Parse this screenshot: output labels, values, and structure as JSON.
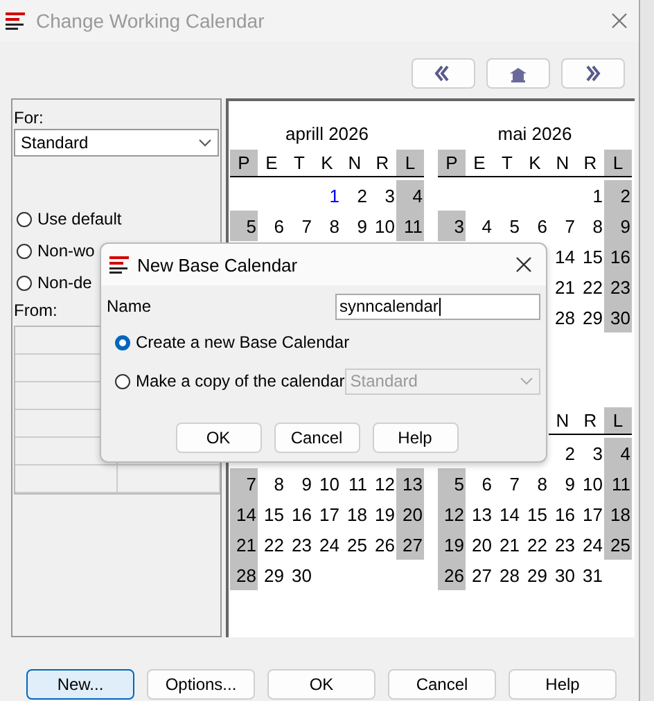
{
  "window": {
    "title": "Change Working Calendar",
    "active": false
  },
  "left_panel": {
    "for_label": "For:",
    "calendar_select": {
      "value": "Standard"
    },
    "options": [
      {
        "label": "Use default",
        "selected": false
      },
      {
        "label": "Non-wo",
        "selected": false
      },
      {
        "label": "Non-de",
        "selected": false
      }
    ],
    "from_label": "From:"
  },
  "calendar": {
    "bands": [
      {
        "months": {
          "left": {
            "title": "aprill 2026",
            "header": {
              "kind": "full",
              "labels": [
                "P",
                "E",
                "T",
                "K",
                "N",
                "R",
                "L"
              ]
            }
          },
          "right": {
            "title": "mai 2026",
            "header": {
              "kind": "full",
              "labels": [
                "P",
                "E",
                "T",
                "K",
                "N",
                "R",
                "L"
              ]
            }
          }
        },
        "weeks": [
          {
            "left": {
              "kind": "start",
              "days": [
                {
                  "day": "1",
                  "today": true
                },
                {
                  "day": "2",
                  "today": false
                },
                {
                  "day": "3",
                  "today": false
                },
                {
                  "day": "4",
                  "today": false
                }
              ]
            },
            "right": {
              "kind": "start",
              "days": [
                {
                  "day": "1",
                  "today": false
                },
                {
                  "day": "2",
                  "today": false
                }
              ]
            }
          },
          {
            "left": {
              "kind": "full",
              "days": [
                {
                  "day": "5",
                  "today": false
                },
                {
                  "day": "6",
                  "today": false
                },
                {
                  "day": "7",
                  "today": false
                },
                {
                  "day": "8",
                  "today": false
                },
                {
                  "day": "9",
                  "today": false
                },
                {
                  "day": "10",
                  "today": false
                },
                {
                  "day": "11",
                  "today": false
                }
              ]
            },
            "right": {
              "kind": "full",
              "days": [
                {
                  "day": "3",
                  "today": false
                },
                {
                  "day": "4",
                  "today": false
                },
                {
                  "day": "5",
                  "today": false
                },
                {
                  "day": "6",
                  "today": false
                },
                {
                  "day": "7",
                  "today": false
                },
                {
                  "day": "8",
                  "today": false
                },
                {
                  "day": "9",
                  "today": false
                }
              ]
            }
          },
          {
            "right": {
              "kind": "start",
              "days": [
                {
                  "day": "14",
                  "today": false
                },
                {
                  "day": "15",
                  "today": false
                },
                {
                  "day": "16",
                  "today": false
                }
              ]
            }
          },
          {
            "right": {
              "kind": "start",
              "days": [
                {
                  "day": "21",
                  "today": false
                },
                {
                  "day": "22",
                  "today": false
                },
                {
                  "day": "23",
                  "today": false
                }
              ]
            }
          },
          {
            "right": {
              "kind": "start",
              "days": [
                {
                  "day": "28",
                  "today": false
                },
                {
                  "day": "29",
                  "today": false
                },
                {
                  "day": "30",
                  "today": false
                }
              ]
            }
          }
        ]
      },
      {
        "months": {
          "right": {
            "header": {
              "kind": "start",
              "labels": [
                "N",
                "R",
                "L"
              ]
            }
          }
        },
        "weeks": [
          {
            "right": {
              "kind": "start",
              "days": [
                {
                  "day": "2",
                  "today": false
                },
                {
                  "day": "3",
                  "today": false
                },
                {
                  "day": "4",
                  "today": false
                }
              ]
            }
          },
          {
            "left": {
              "kind": "full",
              "days": [
                {
                  "day": "7",
                  "today": false
                },
                {
                  "day": "8",
                  "today": false
                },
                {
                  "day": "9",
                  "today": false
                },
                {
                  "day": "10",
                  "today": false
                },
                {
                  "day": "11",
                  "today": false
                },
                {
                  "day": "12",
                  "today": false
                },
                {
                  "day": "13",
                  "today": false
                }
              ]
            },
            "right": {
              "kind": "full",
              "days": [
                {
                  "day": "5",
                  "today": false
                },
                {
                  "day": "6",
                  "today": false
                },
                {
                  "day": "7",
                  "today": false
                },
                {
                  "day": "8",
                  "today": false
                },
                {
                  "day": "9",
                  "today": false
                },
                {
                  "day": "10",
                  "today": false
                },
                {
                  "day": "11",
                  "today": false
                }
              ]
            }
          },
          {
            "left": {
              "kind": "full",
              "days": [
                {
                  "day": "14",
                  "today": false
                },
                {
                  "day": "15",
                  "today": false
                },
                {
                  "day": "16",
                  "today": false
                },
                {
                  "day": "17",
                  "today": false
                },
                {
                  "day": "18",
                  "today": false
                },
                {
                  "day": "19",
                  "today": false
                },
                {
                  "day": "20",
                  "today": false
                }
              ]
            },
            "right": {
              "kind": "full",
              "days": [
                {
                  "day": "12",
                  "today": false
                },
                {
                  "day": "13",
                  "today": false
                },
                {
                  "day": "14",
                  "today": false
                },
                {
                  "day": "15",
                  "today": false
                },
                {
                  "day": "16",
                  "today": false
                },
                {
                  "day": "17",
                  "today": false
                },
                {
                  "day": "18",
                  "today": false
                }
              ]
            }
          },
          {
            "left": {
              "kind": "full",
              "days": [
                {
                  "day": "21",
                  "today": false
                },
                {
                  "day": "22",
                  "today": false
                },
                {
                  "day": "23",
                  "today": false
                },
                {
                  "day": "24",
                  "today": false
                },
                {
                  "day": "25",
                  "today": false
                },
                {
                  "day": "26",
                  "today": false
                },
                {
                  "day": "27",
                  "today": false
                }
              ]
            },
            "right": {
              "kind": "full",
              "days": [
                {
                  "day": "19",
                  "today": false
                },
                {
                  "day": "20",
                  "today": false
                },
                {
                  "day": "21",
                  "today": false
                },
                {
                  "day": "22",
                  "today": false
                },
                {
                  "day": "23",
                  "today": false
                },
                {
                  "day": "24",
                  "today": false
                },
                {
                  "day": "25",
                  "today": false
                }
              ]
            }
          },
          {
            "left": {
              "kind": "end",
              "days": [
                {
                  "day": "28",
                  "today": false
                },
                {
                  "day": "29",
                  "today": false
                },
                {
                  "day": "30",
                  "today": false
                }
              ]
            },
            "right": {
              "kind": "end",
              "days": [
                {
                  "day": "26",
                  "today": false
                },
                {
                  "day": "27",
                  "today": false
                },
                {
                  "day": "28",
                  "today": false
                },
                {
                  "day": "29",
                  "today": false
                },
                {
                  "day": "30",
                  "today": false
                },
                {
                  "day": "31",
                  "today": false
                }
              ]
            }
          }
        ]
      }
    ]
  },
  "buttons": [
    {
      "label": "New...",
      "focused": true
    },
    {
      "label": "Options...",
      "focused": false
    },
    {
      "label": "OK",
      "focused": false
    },
    {
      "label": "Cancel",
      "focused": false
    },
    {
      "label": "Help",
      "focused": false
    }
  ],
  "dialog": {
    "title": "New Base Calendar",
    "name_label": "Name",
    "name_value": "synncalendar",
    "options": [
      {
        "label": "Create a new Base Calendar",
        "selected": true
      },
      {
        "label": "Make a copy of the calendar",
        "selected": false
      }
    ],
    "copy_source": {
      "value": "Standard",
      "disabled": true
    },
    "buttons": [
      "OK",
      "Cancel",
      "Help"
    ]
  }
}
